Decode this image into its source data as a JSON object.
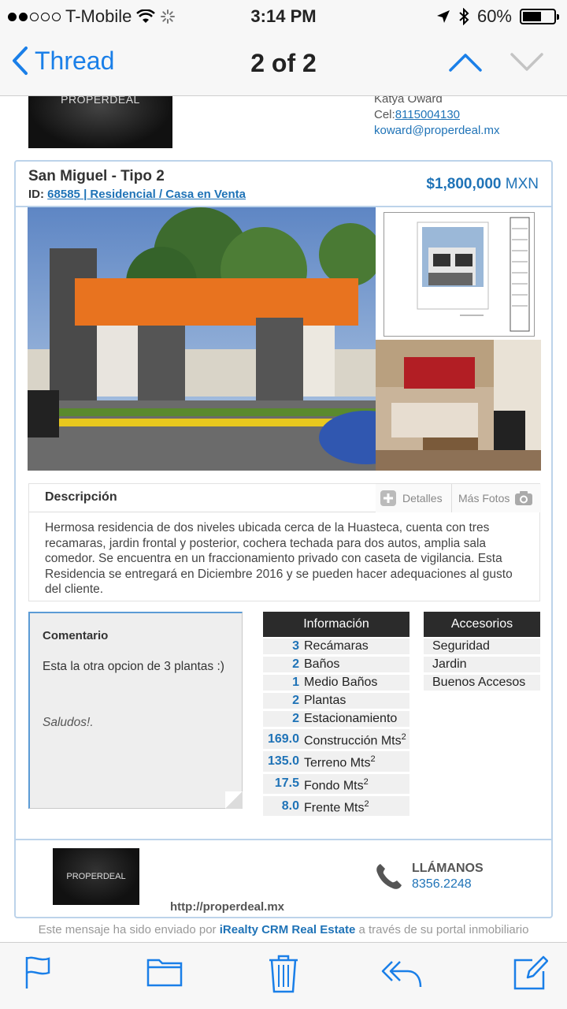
{
  "status": {
    "carrier": "T-Mobile",
    "time": "3:14 PM",
    "battery": "60%",
    "battery_level": 0.6
  },
  "nav": {
    "back_label": "Thread",
    "title": "2 of 2"
  },
  "header": {
    "logo_text": "PROPERDEAL",
    "agent_name": "Katya Oward",
    "cel_label": "Cel:",
    "cel_value": "8115004130",
    "email": "koward@properdeal.mx"
  },
  "listing": {
    "title": "San Miguel - Tipo 2",
    "id_label": "ID:",
    "id_value": "68585",
    "category": "| Residencial / Casa en Venta",
    "price": "$1,800,000",
    "currency": "MXN"
  },
  "description": {
    "heading": "Descripción",
    "tab_details": "Detalles",
    "tab_photos": "Más Fotos",
    "text": "Hermosa residencia de dos niveles ubicada cerca de la Huasteca, cuenta con tres recamaras, jardin frontal y posterior, cochera techada para dos autos, amplia sala comedor. Se encuentra en un fraccionamiento privado con caseta de vigilancia. Esta Residencia se entregará en Diciembre 2016 y se pueden hacer adequaciones al gusto del cliente."
  },
  "comment": {
    "title": "Comentario",
    "body": "Esta la otra opcion de 3 plantas :)",
    "signoff": "Saludos!."
  },
  "info": {
    "heading": "Información",
    "rows": [
      {
        "n": "3",
        "label": "Recámaras"
      },
      {
        "n": "2",
        "label": "Baños"
      },
      {
        "n": "1",
        "label": "Medio Baños"
      },
      {
        "n": "2",
        "label": "Plantas"
      },
      {
        "n": "2",
        "label": "Estacionamiento"
      },
      {
        "n": "169.0",
        "label": "Construcción Mts",
        "sup": "2"
      },
      {
        "n": "135.0",
        "label": "Terreno Mts",
        "sup": "2"
      },
      {
        "n": "17.5",
        "label": "Fondo Mts",
        "sup": "2"
      },
      {
        "n": "8.0",
        "label": "Frente Mts",
        "sup": "2"
      }
    ]
  },
  "accessories": {
    "heading": "Accesorios",
    "items": [
      "Seguridad",
      "Jardin",
      "Buenos Accesos"
    ]
  },
  "footer": {
    "logo_text": "PROPERDEAL",
    "url": "http://properdeal.mx",
    "call_label": "LLÁMANOS",
    "phone": "8356.2248",
    "note_prefix": "Este mensaje ha sido enviado por",
    "note_brand": "iRealty CRM Real Estate",
    "note_suffix": "a través de su portal inmobiliario"
  },
  "colors": {
    "accent": "#1a7fe8",
    "link": "#1f73b7",
    "card_border": "#bcd3ea",
    "table_header": "#2b2b2b"
  },
  "icons": [
    "wifi-icon",
    "activity-spinner-icon",
    "location-arrow-icon",
    "bluetooth-icon",
    "flag-icon",
    "folder-icon",
    "trash-icon",
    "reply-icon",
    "compose-icon"
  ]
}
